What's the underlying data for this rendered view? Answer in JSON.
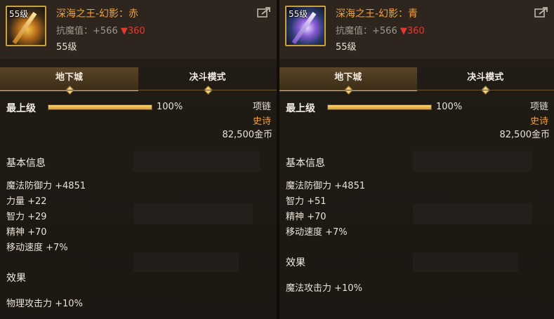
{
  "items": [
    {
      "icon_level": "55级",
      "title": "深海之王-幻影：赤",
      "anti_magic_label": "抗魔值：",
      "anti_magic_value": "+566",
      "anti_magic_down": "▼360",
      "level": "55级",
      "tabs": [
        "地下城",
        "决斗模式"
      ],
      "active_tab": 0,
      "max_level_label": "最上级",
      "max_level_progress": 1.0,
      "max_level_pct": "100%",
      "slot": "项链",
      "rarity": "史诗",
      "price": "82,500金币",
      "basic_info_title": "基本信息",
      "stats": [
        "魔法防御力 +4851",
        "力量 +22",
        "智力 +29",
        "精神 +70",
        "移动速度 +7%"
      ],
      "effects_title": "效果",
      "effects": [
        "物理攻击力 +10%"
      ],
      "icon_theme": "gold-red",
      "share_icon": "share-icon"
    },
    {
      "icon_level": "55级",
      "title": "深海之王-幻影：青",
      "anti_magic_label": "抗魔值：",
      "anti_magic_value": "+566",
      "anti_magic_down": "▼360",
      "level": "55级",
      "tabs": [
        "地下城",
        "决斗模式"
      ],
      "active_tab": 0,
      "max_level_label": "最上级",
      "max_level_progress": 1.0,
      "max_level_pct": "100%",
      "slot": "项链",
      "rarity": "史诗",
      "price": "82,500金币",
      "basic_info_title": "基本信息",
      "stats": [
        "魔法防御力 +4851",
        "智力 +51",
        "精神 +70",
        "移动速度 +7%"
      ],
      "effects_title": "效果",
      "effects": [
        "魔法攻击力 +10%"
      ],
      "icon_theme": "blue-purple",
      "share_icon": "share-icon"
    }
  ],
  "colors": {
    "title": "#f0a23c",
    "down": "#e23a2f",
    "rarity_epic": "#f0a23c",
    "tab_accent": "#e2b24a"
  }
}
